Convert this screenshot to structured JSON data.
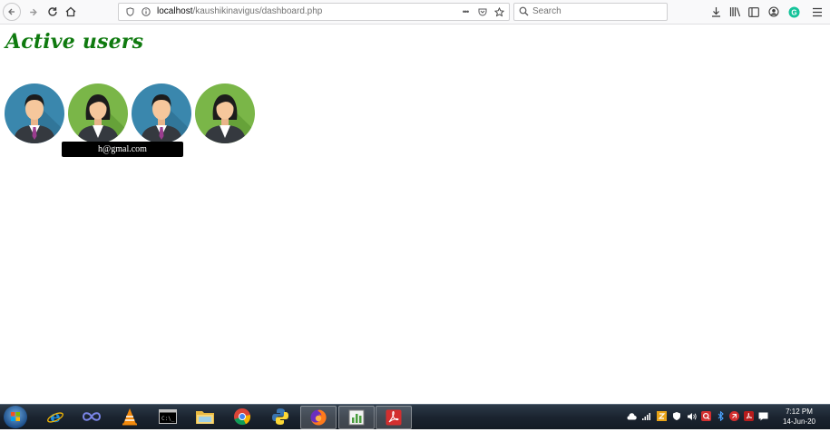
{
  "browser": {
    "url_host": "localhost",
    "url_path": "/kaushikinavigus/dashboard.php",
    "search_placeholder": "Search",
    "page_actions_label": "•••"
  },
  "page": {
    "title": "Active users",
    "users": [
      {
        "gender": "male"
      },
      {
        "gender": "female"
      },
      {
        "gender": "male"
      },
      {
        "gender": "female"
      }
    ],
    "tooltip": "h@gmal.com"
  },
  "taskbar": {
    "apps": [
      "internet-explorer",
      "app-infinity",
      "vlc",
      "command-prompt",
      "file-explorer",
      "chrome",
      "python",
      "firefox",
      "spreadsheet-app",
      "acrobat"
    ],
    "clock_time": "7:12 PM",
    "clock_date": "14-Jun-20"
  },
  "colors": {
    "title_green": "#0f7a0f",
    "male_bg": "#3a87ad",
    "female_bg": "#7ab648",
    "suit": "#35393f",
    "tie": "#9b3d8f"
  }
}
